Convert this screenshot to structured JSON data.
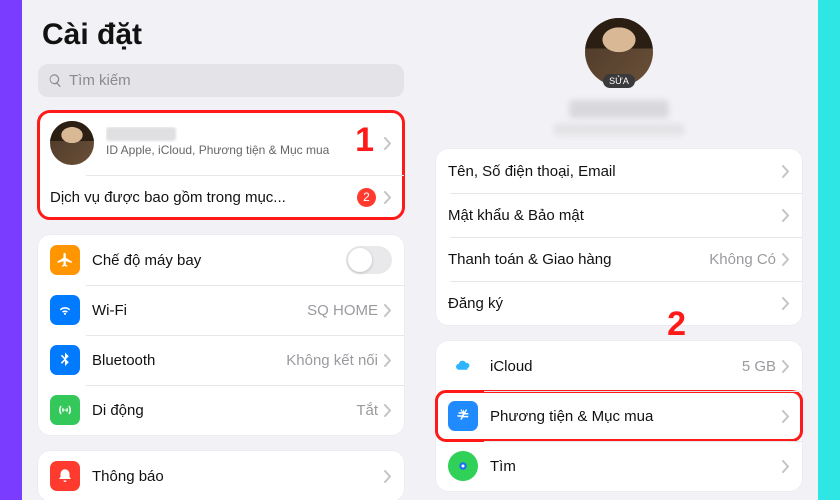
{
  "left": {
    "title": "Cài đặt",
    "search_placeholder": "Tìm kiếm",
    "profile_subtitle": "ID Apple, iCloud, Phương tiện & Mục mua",
    "services_label": "Dịch vụ được bao gồm trong mục...",
    "services_badge": "2",
    "airplane": "Chế độ máy bay",
    "wifi": "Wi-Fi",
    "wifi_value": "SQ HOME",
    "bluetooth": "Bluetooth",
    "bluetooth_value": "Không kết nối",
    "cellular": "Di động",
    "cellular_value": "Tắt",
    "notifications": "Thông báo"
  },
  "right": {
    "edit_tag": "SỬA",
    "name_phone": "Tên, Số điện thoại, Email",
    "password": "Mật khẩu & Bảo mật",
    "payment": "Thanh toán & Giao hàng",
    "payment_value": "Không Có",
    "subscription": "Đăng ký",
    "icloud": "iCloud",
    "icloud_value": "5 GB",
    "media": "Phương tiện & Mục mua",
    "find": "Tìm"
  },
  "callouts": {
    "one": "1",
    "two": "2"
  }
}
